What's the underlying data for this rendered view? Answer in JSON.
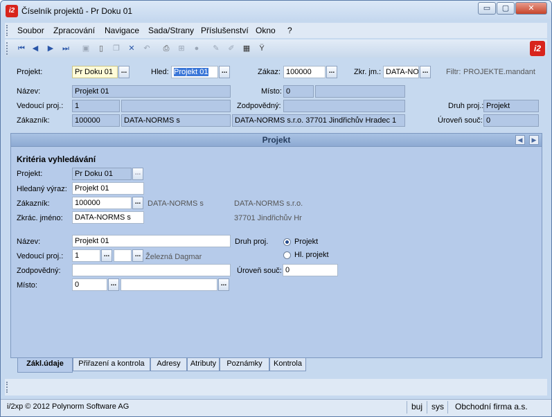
{
  "window": {
    "title": "Číselník projektů - Pr Doku 01",
    "logo": "i2",
    "min": "▭",
    "max": "▢",
    "close": "✕"
  },
  "menu": [
    "Soubor",
    "Zpracování",
    "Navigace",
    "Sada/Strany",
    "Příslušenství",
    "Okno",
    "?"
  ],
  "toolbar_icons": [
    "first-icon",
    "prev-icon",
    "next-icon",
    "last-icon",
    "save-icon",
    "new-icon",
    "copy-icon",
    "delete-icon",
    "undo-icon",
    "print-icon",
    "tree-icon",
    "stop-icon",
    "edit-icon",
    "edit2-icon",
    "table-icon",
    "filter-icon"
  ],
  "header": {
    "projekt_label": "Projekt:",
    "projekt_value": "Pr Doku 01",
    "hled_label": "Hled:",
    "hled_value": "Projekt 01",
    "zakaz_label": "Zákaz:",
    "zakaz_value": "100000",
    "zkr_label": "Zkr. jm.:",
    "zkr_value": "DATA-NO",
    "filtr_label": "Filtr:",
    "filtr_value": "PROJEKTE.mandant",
    "nazev_label": "Název:",
    "nazev_value": "Projekt 01",
    "misto_label": "Místo:",
    "misto_value": "0",
    "vedouci_label": "Vedoucí proj.:",
    "vedouci_value": "1",
    "zodpovedny_label": "Zodpovědný:",
    "druh_label": "Druh proj.:",
    "druh_value": "Projekt",
    "zakaznik_label": "Zákazník:",
    "zakaznik_code": "100000",
    "zakaznik_name": "DATA-NORMS s",
    "zakaznik_full": "DATA-NORMS s.r.o. 37701 Jindřichův Hradec 1",
    "uroven_label": "Úroveň souč:",
    "uroven_value": "0"
  },
  "panel": {
    "title": "Projekt",
    "section": "Kritéria vyhledávání",
    "projekt_label": "Projekt:",
    "projekt_value": "Pr Doku 01",
    "hledany_label": "Hledaný výraz:",
    "hledany_value": "Projekt 01",
    "zakaznik_label": "Zákazník:",
    "zakaznik_value": "100000",
    "zakaznik_name": "DATA-NORMS s",
    "zakaznik_name2": "DATA-NORMS s.r.o.",
    "zkrac_label": "Zkrác. jméno:",
    "zkrac_value": "DATA-NORMS s",
    "address": "37701  Jindřichův Hr",
    "nazev_label": "Název:",
    "nazev_value": "Projekt 01",
    "druh_label": "Druh proj.",
    "radio1": "Projekt",
    "radio2": "Hl. projekt",
    "vedouci_label": "Vedoucí proj.:",
    "vedouci_value": "1",
    "vedouci_name": "Železná Dagmar",
    "zodpovedny_label": "Zodpovědný:",
    "uroven_label": "Úroveň souč:",
    "uroven_value": "0",
    "misto_label": "Místo:",
    "misto_value": "0"
  },
  "tabs": [
    "Zákl.údaje",
    "Přiřazení a kontrola",
    "Adresy",
    "Atributy",
    "Poznámky",
    "Kontrola"
  ],
  "status": {
    "copyright": "i/2xp © 2012 Polynorm Software AG",
    "user": "buj",
    "db": "sys",
    "company": "Obchodní firma a.s."
  }
}
